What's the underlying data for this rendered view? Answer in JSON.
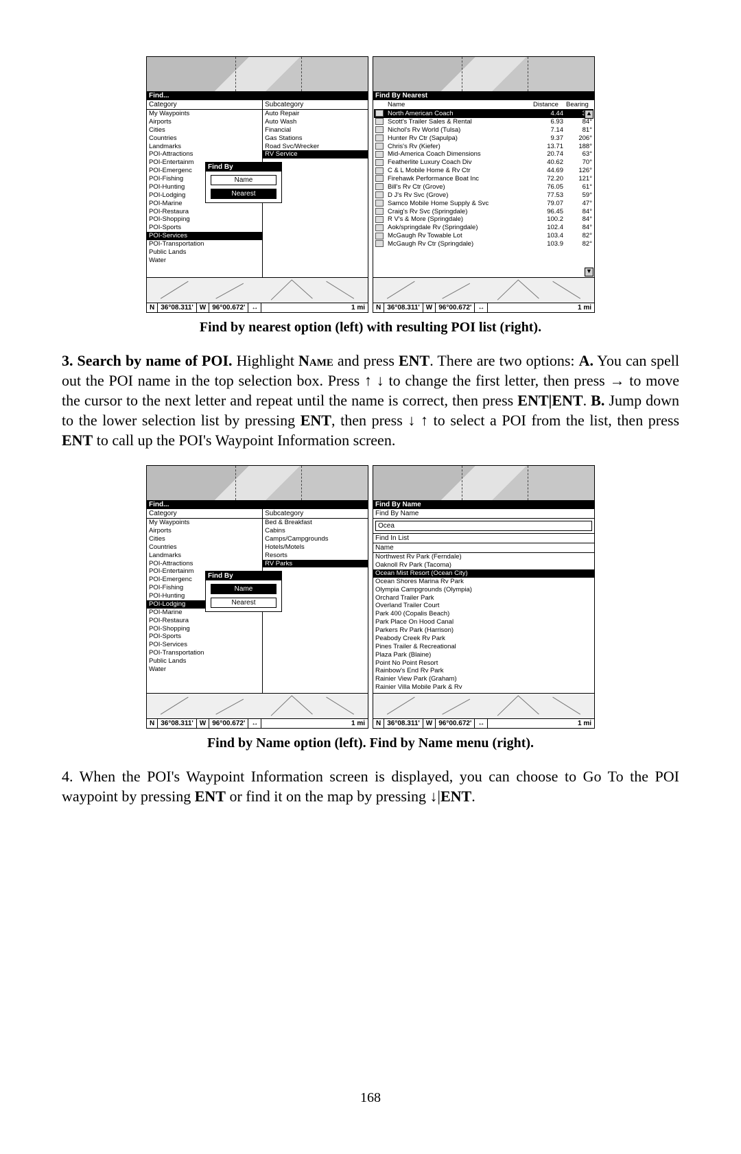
{
  "page_number": "168",
  "caption1": "Find by nearest option (left) with resulting POI list (right).",
  "caption2": "Find by Name option (left). Find by Name menu (right).",
  "para3_lead": "3. Search by name of POI.",
  "para3_a": " Highlight ",
  "para3_name": "Name",
  "para3_b": " and press ",
  "para3_ent": "ENT",
  "para3_c": ". There are two options: ",
  "para3_A": "A.",
  "para3_d": " You can spell out the POI name in the top selection box. Press ",
  "para3_e": " to change the first letter, then press ",
  "para3_f": " to move the cursor to the next letter and repeat until the name is correct, then press ",
  "para3_entent": "ENT|ENT",
  "para3_g": ". ",
  "para3_B": "B.",
  "para3_h": " Jump down to the lower selection list by pressing ",
  "para3_i": ", then press ",
  "para3_j": " to select a POI from the list, then press ",
  "para3_k": " to call up the POI's Waypoint Information screen.",
  "para4_a": "4. When the POI's Waypoint Information screen is displayed, you can choose to Go To the POI waypoint by pressing ",
  "para4_b": " or find it on the map by pressing ",
  "para4_c": ".",
  "fig1": {
    "left": {
      "title": "Find...",
      "cat_head": "Category",
      "sub_head": "Subcategory",
      "cats": [
        "My Waypoints",
        "Airports",
        "Cities",
        "Countries",
        "Landmarks",
        "POI-Attractions",
        "POI-Entertainm",
        "POI-Emergenc",
        "POI-Fishing",
        "POI-Hunting",
        "POI-Lodging",
        "POI-Marine",
        "POI-Restaura",
        "POI-Shopping",
        "POI-Sports",
        "POI-Services",
        "POI-Transportation",
        "Public Lands",
        "Water"
      ],
      "cat_sel": 15,
      "subs": [
        "Auto Repair",
        "Auto Wash",
        "Financial",
        "Gas Stations",
        "Road Svc/Wrecker",
        "RV Service"
      ],
      "sub_sel": 5,
      "overlay_title": "Find By",
      "btn_name": "Name",
      "btn_nearest": "Nearest",
      "btn_sel": "nearest"
    },
    "right": {
      "title": "Find By Nearest",
      "headers": [
        "Name",
        "Distance",
        "Bearing"
      ],
      "rows": [
        {
          "n": "North American Coach",
          "d": "4.44",
          "b": "37°",
          "sel": true
        },
        {
          "n": "Scott's Trailer Sales & Rental",
          "d": "6.93",
          "b": "84°"
        },
        {
          "n": "Nichol's Rv World (Tulsa)",
          "d": "7.14",
          "b": "81°"
        },
        {
          "n": "Hunter Rv Ctr (Sapulpa)",
          "d": "9.37",
          "b": "206°"
        },
        {
          "n": "Chris's Rv (Kiefer)",
          "d": "13.71",
          "b": "188°"
        },
        {
          "n": "Mid-America Coach Dimensions",
          "d": "20.74",
          "b": "63°"
        },
        {
          "n": "Featherlite Luxury Coach Div",
          "d": "40.62",
          "b": "70°"
        },
        {
          "n": "C & L Mobile Home & Rv Ctr",
          "d": "44.69",
          "b": "126°"
        },
        {
          "n": "Firehawk Performance Boat Inc",
          "d": "72.20",
          "b": "121°"
        },
        {
          "n": "Bill's Rv Ctr (Grove)",
          "d": "76.05",
          "b": "61°"
        },
        {
          "n": "D J's Rv Svc (Grove)",
          "d": "77.53",
          "b": "59°"
        },
        {
          "n": "Samco Mobile Home Supply & Svc",
          "d": "79.07",
          "b": "47°"
        },
        {
          "n": "Craig's Rv Svc (Springdale)",
          "d": "96.45",
          "b": "84°"
        },
        {
          "n": "R V's & More (Springdale)",
          "d": "100.2",
          "b": "84°"
        },
        {
          "n": "Aok/springdale Rv (Springdale)",
          "d": "102.4",
          "b": "84°"
        },
        {
          "n": "McGaugh Rv Towable Lot",
          "d": "103.4",
          "b": "82°"
        },
        {
          "n": "McGaugh Rv Ctr (Springdale)",
          "d": "103.9",
          "b": "82°"
        }
      ]
    },
    "status": {
      "n": "N",
      "lat": "36°08.311'",
      "w": "W",
      "lon": "96°00.672'",
      "scale": "1 mi"
    }
  },
  "fig2": {
    "left": {
      "title": "Find...",
      "cat_head": "Category",
      "sub_head": "Subcategory",
      "cats": [
        "My Waypoints",
        "Airports",
        "Cities",
        "Countries",
        "Landmarks",
        "POI-Attractions",
        "POI-Entertainm",
        "POI-Emergenc",
        "POI-Fishing",
        "POI-Hunting",
        "POI-Lodging",
        "POI-Marine",
        "POI-Restaura",
        "POI-Shopping",
        "POI-Sports",
        "POI-Services",
        "POI-Transportation",
        "Public Lands",
        "Water"
      ],
      "cat_sel": 10,
      "subs": [
        "Bed & Breakfast",
        "Cabins",
        "Camps/Campgrounds",
        "Hotels/Motels",
        "Resorts",
        "RV Parks"
      ],
      "sub_sel": 5,
      "overlay_title": "Find By",
      "btn_name": "Name",
      "btn_nearest": "Nearest",
      "btn_sel": "name"
    },
    "right": {
      "title": "Find By Name",
      "section1": "Find By Name",
      "input": "Ocea",
      "section2": "Find In List",
      "listhead": "Name",
      "items": [
        "Northwest Rv Park (Ferndale)",
        "Oaknoll Rv Park (Tacoma)",
        "Ocean Mist Resort (Ocean City)",
        "Ocean Shores Marina Rv Park",
        "Olympia Campgrounds (Olympia)",
        "Orchard Trailer Park",
        "Overland Trailer Court",
        "Park 400 (Copalis Beach)",
        "Park Place On Hood Canal",
        "Parkers Rv Park (Harrison)",
        "Peabody Creek Rv Park",
        "Pines Trailer & Recreational",
        "Plaza Park (Blaine)",
        "Point No Point Resort",
        "Rainbow's End Rv Park",
        "Rainier View Park (Graham)",
        "Rainier Villa Mobile Park & Rv"
      ],
      "sel": 2
    },
    "status": {
      "n": "N",
      "lat": "36°08.311'",
      "w": "W",
      "lon": "96°00.672'",
      "scale": "1 mi"
    }
  }
}
